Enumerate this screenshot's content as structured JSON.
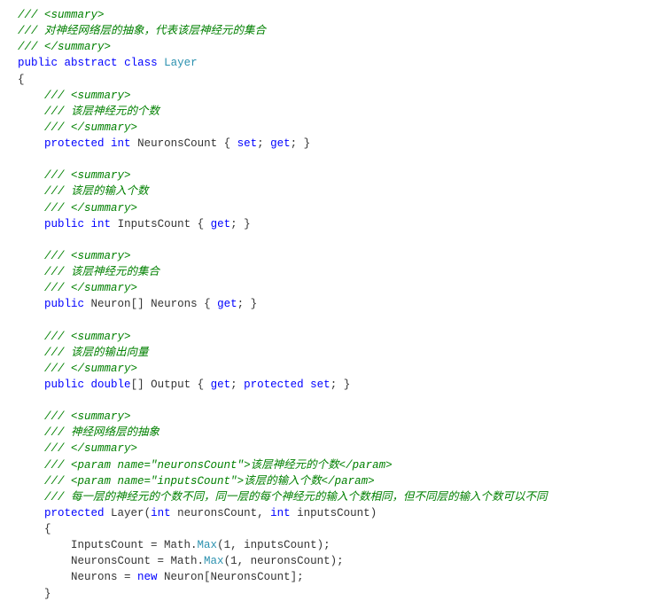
{
  "code": {
    "l01a": "///",
    "l01b": " <summary>",
    "l02a": "///",
    "l02b": " 对神经网络层的抽象，代表该层神经元的集合",
    "l03a": "///",
    "l03b": " </summary>",
    "l04_public": "public",
    "l04_abstract": "abstract",
    "l04_class": "class",
    "l04_name": "Layer",
    "l05_brace": "{",
    "l06a": "///",
    "l06b": " <summary>",
    "l07a": "///",
    "l07b": " 该层神经元的个数",
    "l08a": "///",
    "l08b": " </summary>",
    "l09_protected": "protected",
    "l09_int": "int",
    "l09_name": "NeuronsCount",
    "l09_set": "set",
    "l09_get": "get",
    "l11a": "///",
    "l11b": " <summary>",
    "l12a": "///",
    "l12b": " 该层的输入个数",
    "l13a": "///",
    "l13b": " </summary>",
    "l14_public": "public",
    "l14_int": "int",
    "l14_name": "InputsCount",
    "l14_get": "get",
    "l16a": "///",
    "l16b": " <summary>",
    "l17a": "///",
    "l17b": " 该层神经元的集合",
    "l18a": "///",
    "l18b": " </summary>",
    "l19_public": "public",
    "l19_type": "Neuron",
    "l19_name": "Neurons",
    "l19_get": "get",
    "l21a": "///",
    "l21b": " <summary>",
    "l22a": "///",
    "l22b": " 该层的输出向量",
    "l23a": "///",
    "l23b": " </summary>",
    "l24_public": "public",
    "l24_double": "double",
    "l24_name": "Output",
    "l24_get": "get",
    "l24_protected": "protected",
    "l24_set": "set",
    "l26a": "///",
    "l26b": " <summary>",
    "l27a": "///",
    "l27b": " 神经网络层的抽象",
    "l28a": "///",
    "l28b": " </summary>",
    "l29a": "///",
    "l29b": " <param name=\"neuronsCount\">该层神经元的个数</param>",
    "l30a": "///",
    "l30b": " <param name=\"inputsCount\">该层的输入个数</param>",
    "l31a": "///",
    "l31b": " 每一层的神经元的个数不同，同一层的每个神经元的输入个数相同，但不同层的输入个数可以不同",
    "l32_protected": "protected",
    "l32_layer": "Layer",
    "l32_int1": "int",
    "l32_p1": "neuronsCount",
    "l32_int2": "int",
    "l32_p2": "inputsCount",
    "l33_brace": "{",
    "l34_lhs": "InputsCount = Math.",
    "l34_max": "Max",
    "l34_args": "(1, inputsCount);",
    "l35_lhs": "NeuronsCount = Math.",
    "l35_max": "Max",
    "l35_args": "(1, neuronsCount);",
    "l36_lhs": "Neurons = ",
    "l36_new": "new",
    "l36_type": " Neuron[NeuronsCount];",
    "l37_brace": "}"
  }
}
